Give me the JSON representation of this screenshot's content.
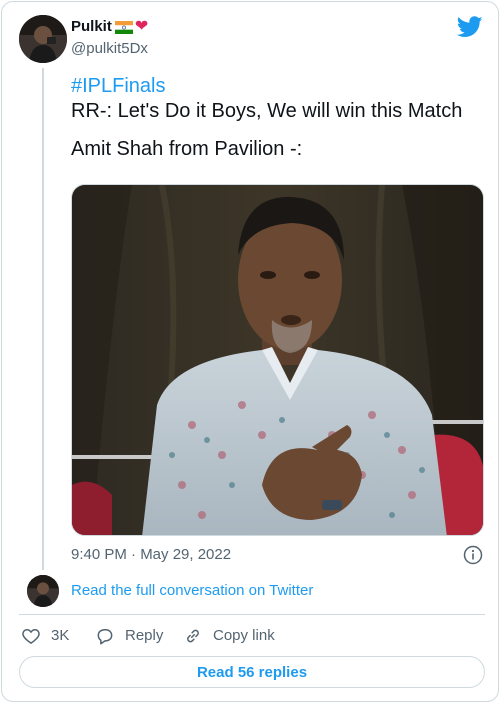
{
  "author": {
    "name": "Pulkit",
    "handle": "@pulkit5Dx",
    "flag": "india-flag-icon",
    "heart": "❤"
  },
  "tweet": {
    "hashtag": "#IPLFinals",
    "line1": "RR-: Let's Do it Boys, We will win this Match",
    "line2": "Amit Shah from Pavilion -:",
    "timestamp": "9:40 PM · May 29, 2022",
    "media_icon": "photo"
  },
  "conversation": {
    "link_text": "Read the full conversation on Twitter"
  },
  "actions": {
    "like_count": "3K",
    "reply_label": "Reply",
    "copy_label": "Copy link"
  },
  "footer": {
    "read_replies": "Read 56 replies"
  },
  "colors": {
    "accent": "#1d9bf0",
    "text": "#0f1419",
    "secondary": "#536471",
    "border": "#cfd9de",
    "heart": "#e0245e"
  }
}
